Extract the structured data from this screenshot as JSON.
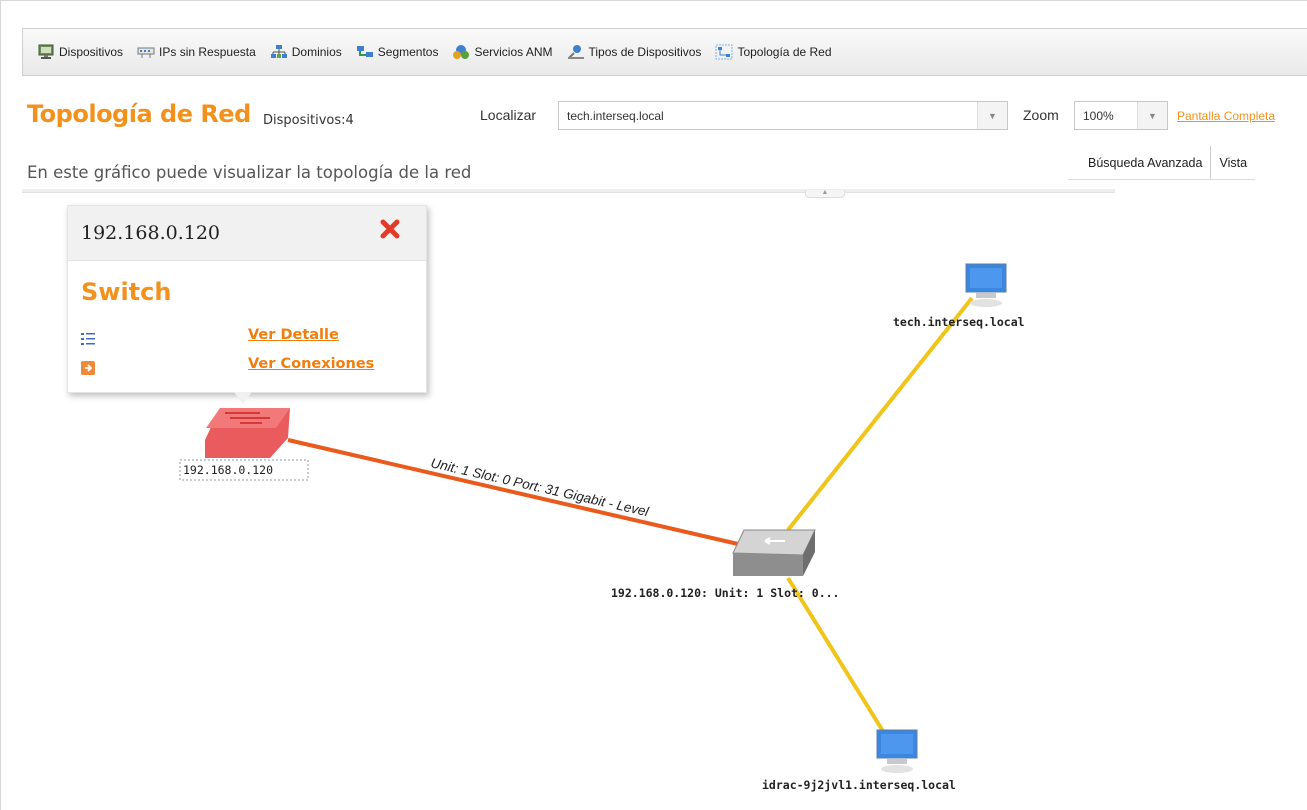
{
  "toolbar": {
    "items": [
      {
        "label": "Dispositivos",
        "icon": "monitor-icon"
      },
      {
        "label": "IPs sin Respuesta",
        "icon": "network-card-icon"
      },
      {
        "label": "Dominios",
        "icon": "domains-icon"
      },
      {
        "label": "Segmentos",
        "icon": "segments-icon"
      },
      {
        "label": "Servicios ANM",
        "icon": "services-icon"
      },
      {
        "label": "Tipos de Dispositivos",
        "icon": "device-types-icon"
      },
      {
        "label": "Topología de Red",
        "icon": "topology-icon"
      }
    ]
  },
  "header": {
    "title": "Topología de Red",
    "device_count": "Dispositivos:4",
    "locate_label": "Localizar",
    "locate_value": "tech.interseq.local",
    "zoom_label": "Zoom",
    "zoom_value": "100%",
    "fullscreen_link": "Pantalla Completa",
    "subtitle": "En este gráfico puede visualizar la topología de la red"
  },
  "tabs": [
    {
      "label": "Búsqueda Avanzada"
    },
    {
      "label": "Vista"
    }
  ],
  "popup": {
    "ip": "192.168.0.120",
    "type": "Switch",
    "detail_link": "Ver Detalle",
    "connections_link": "Ver Conexiones"
  },
  "topology": {
    "nodes": [
      {
        "id": "switch",
        "label": "192.168.0.120",
        "kind": "switch",
        "color": "#e8494b"
      },
      {
        "id": "port",
        "label": "192.168.0.120: Unit: 1 Slot: 0...",
        "kind": "port-switch",
        "color": "#8a8a8a"
      },
      {
        "id": "tech",
        "label": "tech.interseq.local",
        "kind": "computer",
        "color": "#3a86e0"
      },
      {
        "id": "idrac",
        "label": "idrac-9j2jvl1.interseq.local",
        "kind": "computer",
        "color": "#3a86e0"
      }
    ],
    "links": [
      {
        "from": "switch",
        "to": "port",
        "label": "Unit: 1 Slot: 0 Port: 31 Gigabit - Level",
        "color": "#ea5a1c"
      },
      {
        "from": "port",
        "to": "tech",
        "label": "",
        "color": "#f0c419"
      },
      {
        "from": "port",
        "to": "idrac",
        "label": "",
        "color": "#f0c419"
      }
    ]
  },
  "colors": {
    "accent": "#f2921d",
    "link_orange": "#f07d0d"
  }
}
